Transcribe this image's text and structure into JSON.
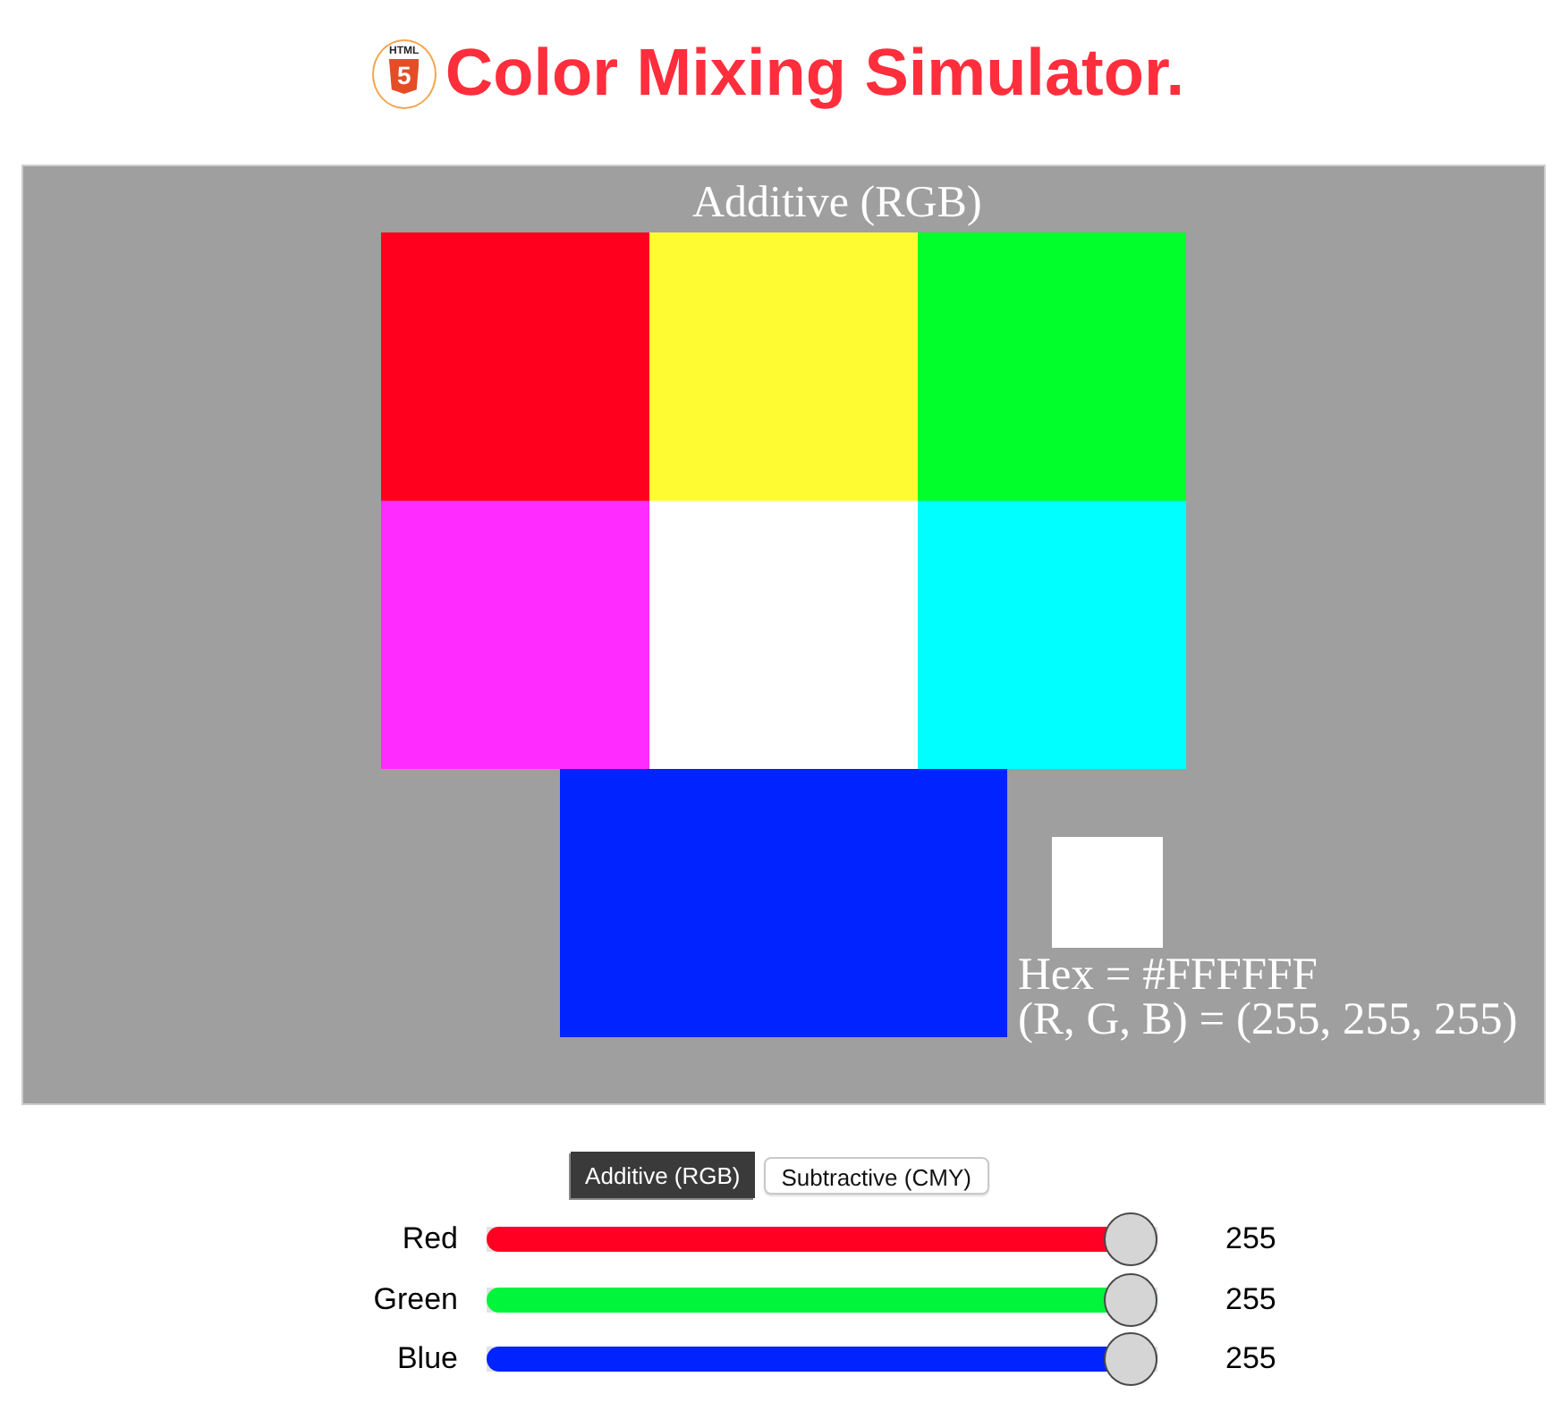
{
  "header": {
    "logo": {
      "label": "HTML",
      "mark": "5"
    },
    "title": "Color Mixing Simulator."
  },
  "canvas": {
    "caption": "Additive (RGB)",
    "tiles": [
      {
        "color": "#ff001f"
      },
      {
        "color": "#fffb33"
      },
      {
        "color": "#00ff2b"
      },
      {
        "color": "#ff2bff"
      },
      {
        "color": "#ffffff"
      },
      {
        "color": "#00ffff"
      }
    ],
    "bottom": {
      "color": "#0023ff"
    },
    "result": {
      "color": "#ffffff",
      "hex": "Hex = #FFFFFF",
      "rgb": "(R, G, B) = (255, 255, 255)"
    }
  },
  "modes": [
    {
      "label": "Additive (RGB)",
      "selected": true
    },
    {
      "label": "Subtractive (CMY)",
      "selected": false
    }
  ],
  "channels": [
    {
      "name": "Red",
      "color": "#ff0022",
      "level": 1,
      "reading": "255"
    },
    {
      "name": "Green",
      "color": "#00f53b",
      "level": 1,
      "reading": "255"
    },
    {
      "name": "Blue",
      "color": "#0023ff",
      "level": 1,
      "reading": "255"
    }
  ]
}
